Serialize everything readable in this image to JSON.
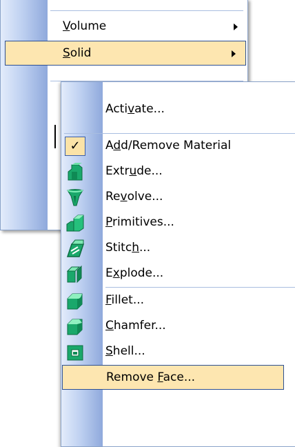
{
  "parent_menu": {
    "items": [
      {
        "label": "Volume",
        "accel": "V",
        "has_submenu": true
      },
      {
        "label": "Solid",
        "accel": "S",
        "has_submenu": true,
        "highlighted": true
      }
    ]
  },
  "solid_submenu": {
    "items": [
      {
        "label": "Activate...",
        "icon": "none"
      },
      {
        "label": "Add/Remove Material",
        "icon": "check-icon",
        "checked": true
      },
      {
        "label": "Extrude...",
        "icon": "extrude-icon"
      },
      {
        "label": "Revolve...",
        "icon": "revolve-icon"
      },
      {
        "label": "Primitives...",
        "icon": "primitives-icon"
      },
      {
        "label": "Stitch...",
        "icon": "stitch-icon"
      },
      {
        "label": "Explode...",
        "icon": "explode-icon"
      },
      {
        "label": "Fillet...",
        "icon": "fillet-icon"
      },
      {
        "label": "Chamfer...",
        "icon": "chamfer-icon"
      },
      {
        "label": "Shell...",
        "icon": "shell-icon"
      },
      {
        "label": "Remove Face...",
        "icon": "none",
        "highlighted": true
      }
    ],
    "check_mark": "✓"
  },
  "colors": {
    "highlight_bg": "#fde6b0",
    "highlight_border": "#2c4f92",
    "strip_dark": "#8fa9dc",
    "icon_green": "#1aa86b"
  }
}
